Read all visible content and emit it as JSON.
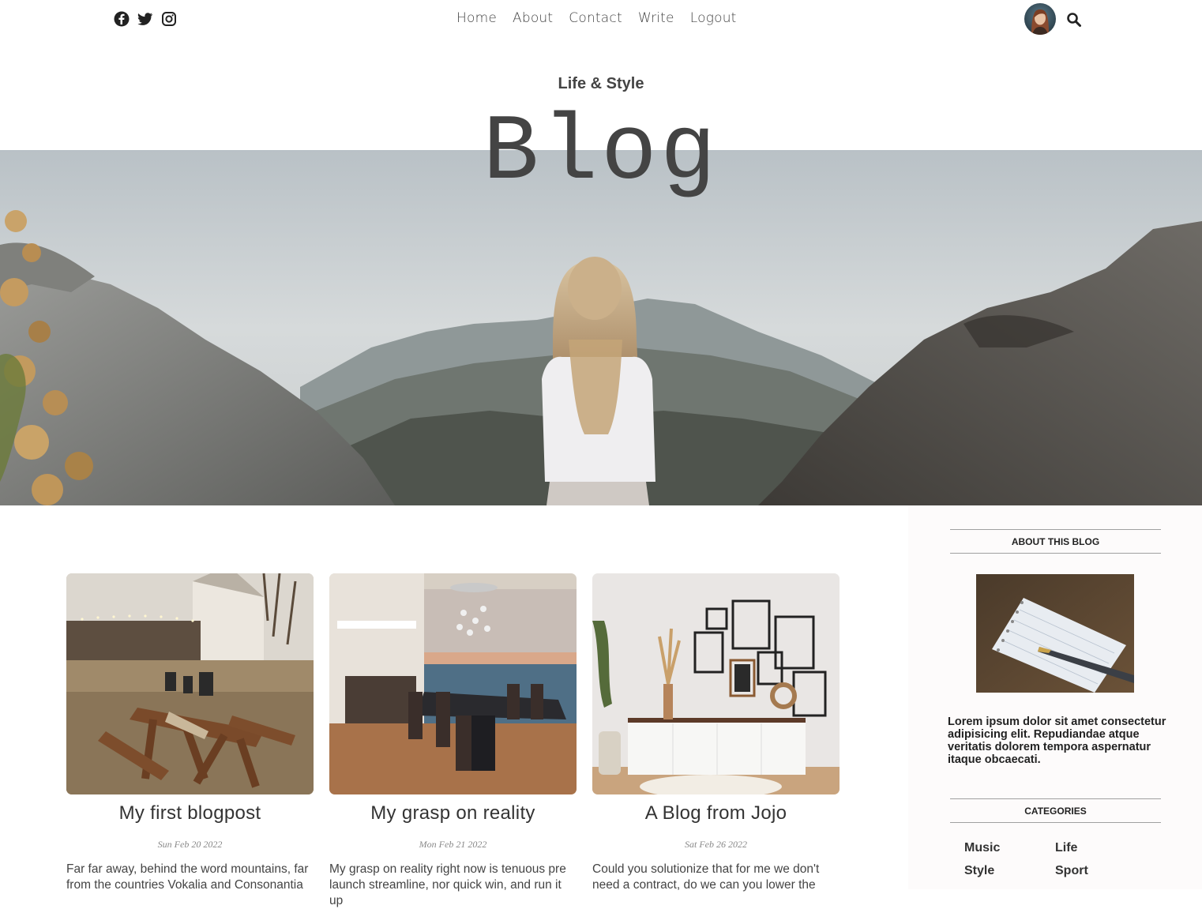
{
  "nav": {
    "social": [
      {
        "name": "facebook-icon"
      },
      {
        "name": "twitter-icon"
      },
      {
        "name": "instagram-icon"
      }
    ],
    "links": [
      "Home",
      "About",
      "Contact",
      "Write",
      "Logout"
    ],
    "search_icon": "search-icon"
  },
  "header": {
    "subtitle": "Life & Style",
    "title": "Blog"
  },
  "posts": [
    {
      "title": "My first blogpost",
      "date": "Sun Feb 20 2022",
      "excerpt": "Far far away, behind the word mountains, far from the countries Vokalia and Consonantia"
    },
    {
      "title": "My grasp on reality",
      "date": "Mon Feb 21 2022",
      "excerpt": "My grasp on reality right now is tenuous pre launch streamline, nor quick win, and run it up"
    },
    {
      "title": "A Blog from Jojo",
      "date": "Sat Feb 26 2022",
      "excerpt": "Could you solutionize that for me we don't need a contract, do we can you lower the"
    }
  ],
  "sidebar": {
    "about_heading": "ABOUT THIS BLOG",
    "about_text": "Lorem ipsum dolor sit amet consectetur adipisicing elit. Repudiandae atque veritatis dolorem tempora aspernatur itaque obcaecati.",
    "categories_heading": "CATEGORIES",
    "categories": [
      "Music",
      "Life",
      "Style",
      "Sport"
    ]
  },
  "colors": {
    "text": "#444444",
    "sidebar_bg": "#fdfbfb"
  }
}
